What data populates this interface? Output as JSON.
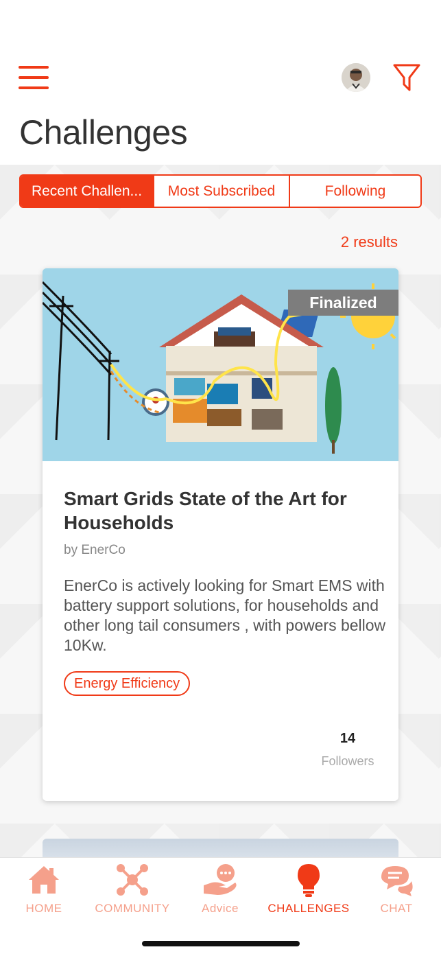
{
  "header": {
    "title": "Challenges",
    "menu_icon": "hamburger-menu-icon",
    "filter_icon": "filter-funnel-icon"
  },
  "tabs": [
    {
      "label": "Recent Challen...",
      "active": true
    },
    {
      "label": "Most Subscribed",
      "active": false
    },
    {
      "label": "Following",
      "active": false
    }
  ],
  "results_text": "2 results",
  "challenges": [
    {
      "status": "Finalized",
      "title": "Smart Grids State of the Art for Households",
      "author": "by EnerCo",
      "description": "EnerCo is actively looking for Smart EMS with battery support solutions, for households and other long tail consumers , with powers bellow 10Kw.",
      "tag": "Energy Efficiency",
      "followers_count": "14",
      "followers_label": "Followers"
    }
  ],
  "bottom_nav": [
    {
      "label": "HOME",
      "icon": "home-icon",
      "active": false
    },
    {
      "label": "COMMUNITY",
      "icon": "community-network-icon",
      "active": false
    },
    {
      "label": "Advice",
      "icon": "advice-hand-chat-icon",
      "active": false
    },
    {
      "label": "CHALLENGES",
      "icon": "lightbulb-icon",
      "active": true
    },
    {
      "label": "CHAT",
      "icon": "chat-bubbles-icon",
      "active": false
    }
  ],
  "colors": {
    "accent": "#f03a17",
    "accent_light": "#f5a08b",
    "badge": "#7d7d7d"
  }
}
